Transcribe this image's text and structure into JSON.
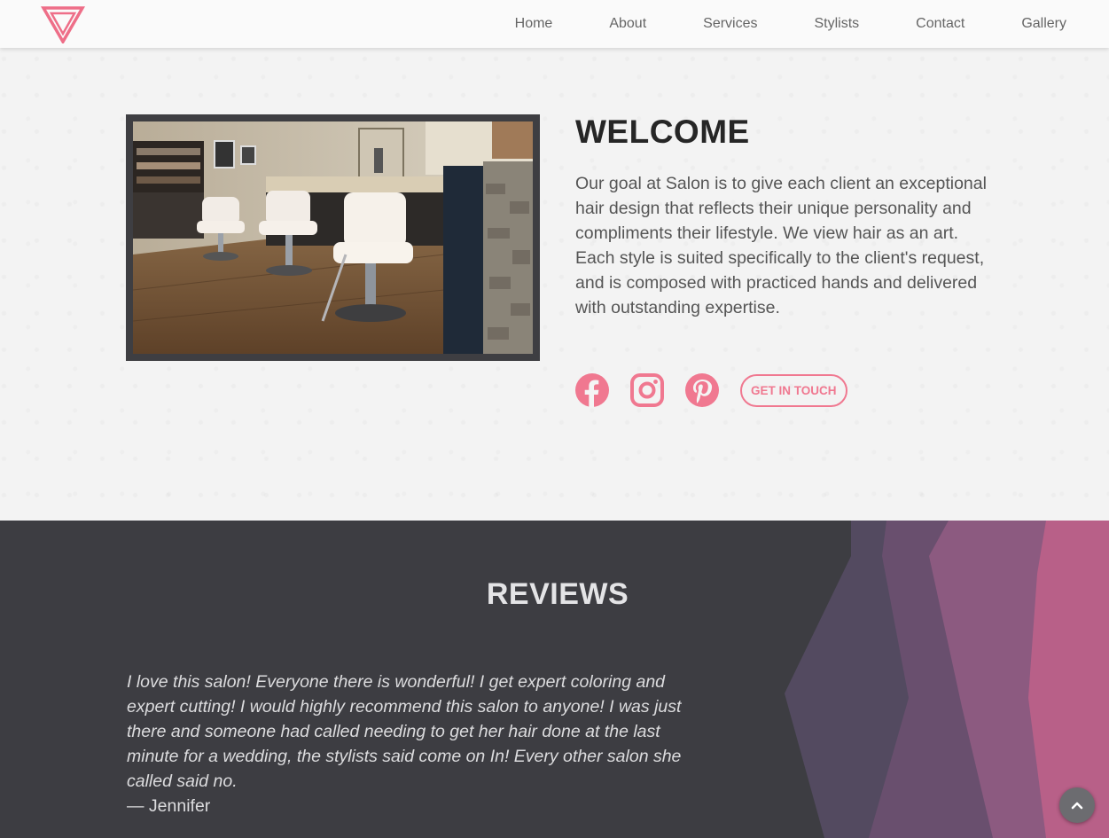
{
  "nav": {
    "logo_icon": "triangle-logo-icon",
    "links": [
      "Home",
      "About",
      "Services",
      "Stylists",
      "Contact",
      "Gallery"
    ]
  },
  "welcome": {
    "title": "WELCOME",
    "text": "Our goal at Salon is to give each client an exceptional hair design that reflects their unique personality and compliments their lifestyle. We view hair as an art. Each style is suited specifically to the client's request, and is composed with practiced hands and delivered with outstanding expertise.",
    "image_alt": "salon interior with styling chairs",
    "socials": [
      "facebook-icon",
      "instagram-icon",
      "pinterest-icon"
    ],
    "cta_label": "GET IN TOUCH"
  },
  "reviews": {
    "title": "REVIEWS",
    "quote": "I love this salon! Everyone there is wonderful! I get expert coloring and expert cutting! I would highly recommend this salon to anyone! I was just there and someone had called needing to get her hair done at the last minute for a wedding, the stylists said come on In! Every other salon she called said no.",
    "author": "— Jennifer"
  },
  "back_to_top_icon": "chevron-up-icon",
  "colors": {
    "accent": "#f07890",
    "dark": "#3d3d42",
    "shape_purple": "#534a60",
    "shape_mauve": "#8c5a80",
    "shape_pink": "#b86088"
  }
}
